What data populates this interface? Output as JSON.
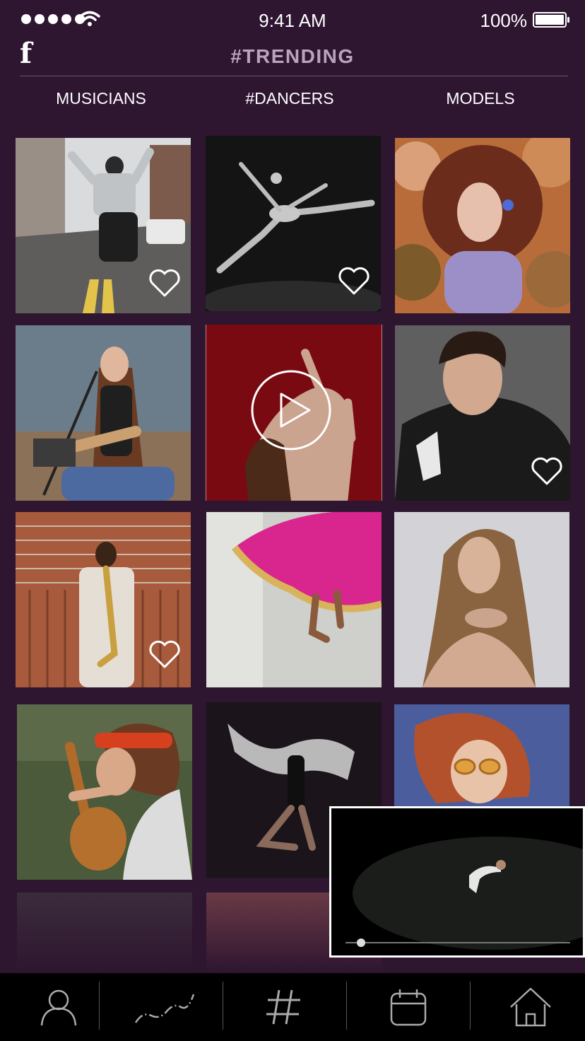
{
  "status_bar": {
    "time": "9:41 AM",
    "battery_percent": "100%",
    "signal_dots": 5,
    "battery_level": 1.0
  },
  "header": {
    "logo": "f",
    "title": "#TRENDING"
  },
  "tabs": [
    {
      "label": "MUSICIANS"
    },
    {
      "label": "#DANCERS"
    },
    {
      "label": "MODELS"
    }
  ],
  "grid": {
    "tiles": [
      {
        "subject": "street dancer",
        "liked": false
      },
      {
        "subject": "ballet leap",
        "liked": false
      },
      {
        "subject": "curly-haired model",
        "liked": false
      },
      {
        "subject": "guitarist singer",
        "liked": false
      },
      {
        "subject": "dancer on red",
        "playing": true
      },
      {
        "subject": "male model in leather jacket",
        "liked": false
      },
      {
        "subject": "saxophonist",
        "liked": false
      },
      {
        "subject": "pink skirt dancer",
        "liked": false
      },
      {
        "subject": "female model",
        "liked": false
      },
      {
        "subject": "guitarist with headband",
        "liked": false
      },
      {
        "subject": "dancer with fabric",
        "liked": false
      },
      {
        "subject": "model with sunglasses",
        "liked": false
      }
    ]
  },
  "mini_player": {
    "progress": 0.07
  },
  "nav": {
    "items": [
      {
        "icon": "person-icon"
      },
      {
        "icon": "trend-icon"
      },
      {
        "icon": "hashtag-icon"
      },
      {
        "icon": "calendar-icon"
      },
      {
        "icon": "home-icon"
      }
    ]
  },
  "colors": {
    "background": "#2e1530",
    "title": "#b9a4bc",
    "nav_background": "#000000"
  }
}
